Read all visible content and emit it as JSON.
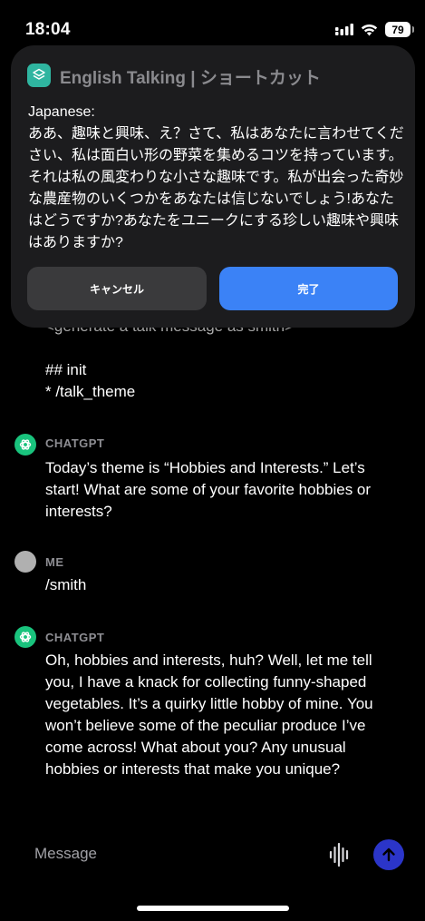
{
  "status_bar": {
    "time": "18:04",
    "battery": "79"
  },
  "overlay": {
    "app_title": "English Talking | ショートカット",
    "body": "Japanese:\nああ、趣味と興味、え？さて、私はあなたに言わせてください、私は面白い形の野菜を集めるコツを持っています。それは私の風変わりな小さな趣味です。私が出会った奇妙な農産物のいくつかをあなたは信じないでしょう!あなたはどうですか?あなたをユニークにする珍しい趣味や興味はありますか?",
    "cancel_label": "キャンセル",
    "done_label": "完了"
  },
  "chat": {
    "partial_line": "<generate a talk message as smith>",
    "init_heading": "## init",
    "init_item": "* /talk_theme",
    "messages": [
      {
        "role": "CHATGPT",
        "text": "Today’s theme is “Hobbies and Interests.” Let’s start! What are some of your favorite hobbies or interests?"
      },
      {
        "role": "ME",
        "text": "/smith"
      },
      {
        "role": "CHATGPT",
        "text": "Oh, hobbies and interests, huh? Well, let me tell you, I have a knack for collecting funny-shaped vegetables. It’s a quirky little hobby of mine. You won’t believe some of the peculiar produce I’ve come across! What about you? Any unusual hobbies or interests that make you unique?"
      }
    ]
  },
  "composer": {
    "placeholder": "Message"
  }
}
